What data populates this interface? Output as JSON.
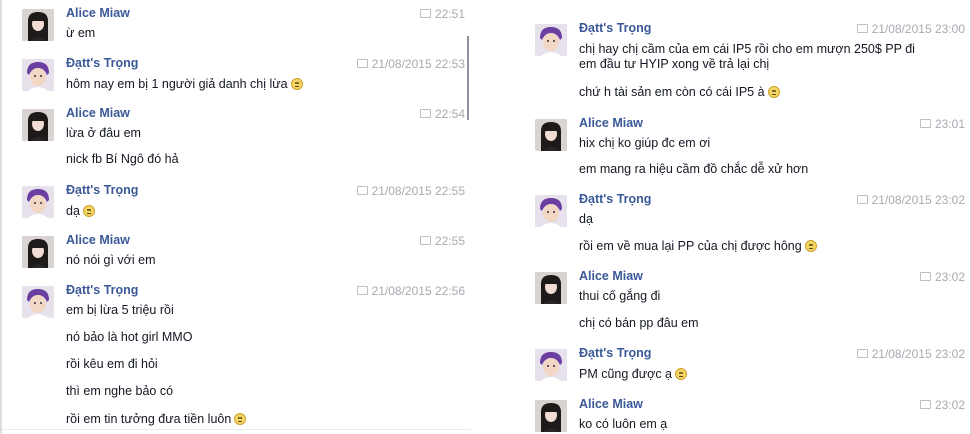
{
  "left": [
    {
      "name": "Alice Miaw",
      "avatar": "alice",
      "date": "",
      "time": "22:51",
      "messages": [
        {
          "text": "ừ em"
        }
      ]
    },
    {
      "name": "Đạtt's Trọng",
      "avatar": "trong",
      "date": "21/08/2015",
      "time": "22:53",
      "messages": [
        {
          "text": "hôm nay em bị 1 người giả danh chị lừa",
          "emoji": true
        }
      ]
    },
    {
      "name": "Alice Miaw",
      "avatar": "alice",
      "date": "",
      "time": "22:54",
      "messages": [
        {
          "text": "lừa ở đâu em"
        },
        {
          "text": "nick fb Bí Ngô đó hả"
        }
      ]
    },
    {
      "name": "Đạtt's Trọng",
      "avatar": "trong",
      "date": "21/08/2015",
      "time": "22:55",
      "messages": [
        {
          "text": "dạ",
          "emoji": true
        }
      ]
    },
    {
      "name": "Alice Miaw",
      "avatar": "alice",
      "date": "",
      "time": "22:55",
      "messages": [
        {
          "text": "nó nói gì với em"
        }
      ]
    },
    {
      "name": "Đạtt's Trọng",
      "avatar": "trong",
      "date": "21/08/2015",
      "time": "22:56",
      "messages": [
        {
          "text": "em bị lừa 5 triệu rồi"
        },
        {
          "text": "nó bảo là hot girl MMO"
        },
        {
          "text": "rồi kêu em đi hỏi"
        },
        {
          "text": "thì em nghe bảo có"
        },
        {
          "text": "rồi em tin tưởng đưa tiền luôn",
          "emoji": true
        }
      ]
    }
  ],
  "right": [
    {
      "name": "Đạtt's Trọng",
      "avatar": "trong",
      "date": "21/08/2015",
      "time": "23:00",
      "messages": [
        {
          "text": "chị hay chị cầm của em cái IP5 rồi cho em mượn 250$ PP đi"
        },
        {
          "text": "em đầu tư HYIP xong về trả lại chị"
        },
        {
          "text": "chứ h tài sản em còn có cái IP5 à",
          "emoji": true
        }
      ]
    },
    {
      "name": "Alice Miaw",
      "avatar": "alice",
      "date": "",
      "time": "23:01",
      "messages": [
        {
          "text": "hix chị ko giúp đc em ơi"
        },
        {
          "text": "em mang ra hiệu cầm đồ chắc dễ xử hơn"
        }
      ]
    },
    {
      "name": "Đạtt's Trọng",
      "avatar": "trong",
      "date": "21/08/2015",
      "time": "23:02",
      "messages": [
        {
          "text": "dạ"
        },
        {
          "text": "rồi em về mua lại PP của chị được hông",
          "emoji": true
        }
      ]
    },
    {
      "name": "Alice Miaw",
      "avatar": "alice",
      "date": "",
      "time": "23:02",
      "messages": [
        {
          "text": "thui cố gắng đi"
        },
        {
          "text": "chị có bán pp đâu em"
        }
      ]
    },
    {
      "name": "Đạtt's Trọng",
      "avatar": "trong",
      "date": "21/08/2015",
      "time": "23:02",
      "messages": [
        {
          "text": "PM cũng được ạ",
          "emoji": true
        }
      ]
    },
    {
      "name": "Alice Miaw",
      "avatar": "alice",
      "date": "",
      "time": "23:02",
      "messages": [
        {
          "text": "ko có luôn em ạ"
        }
      ]
    }
  ]
}
